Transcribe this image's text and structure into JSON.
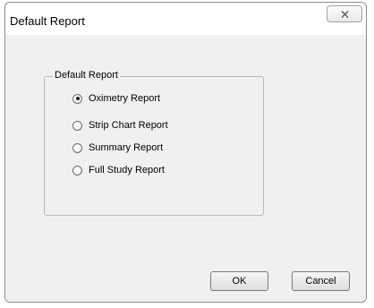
{
  "window": {
    "title": "Default Report",
    "close_icon": "close-x-icon"
  },
  "group": {
    "legend": "Default Report",
    "selected": "Oximetry Report",
    "options": [
      {
        "label": "Oximetry Report",
        "checked": true
      },
      {
        "label": "Strip Chart Report",
        "checked": false
      },
      {
        "label": "Summary Report",
        "checked": false
      },
      {
        "label": "Full Study Report",
        "checked": false
      }
    ]
  },
  "buttons": {
    "ok_label": "OK",
    "cancel_label": "Cancel"
  }
}
